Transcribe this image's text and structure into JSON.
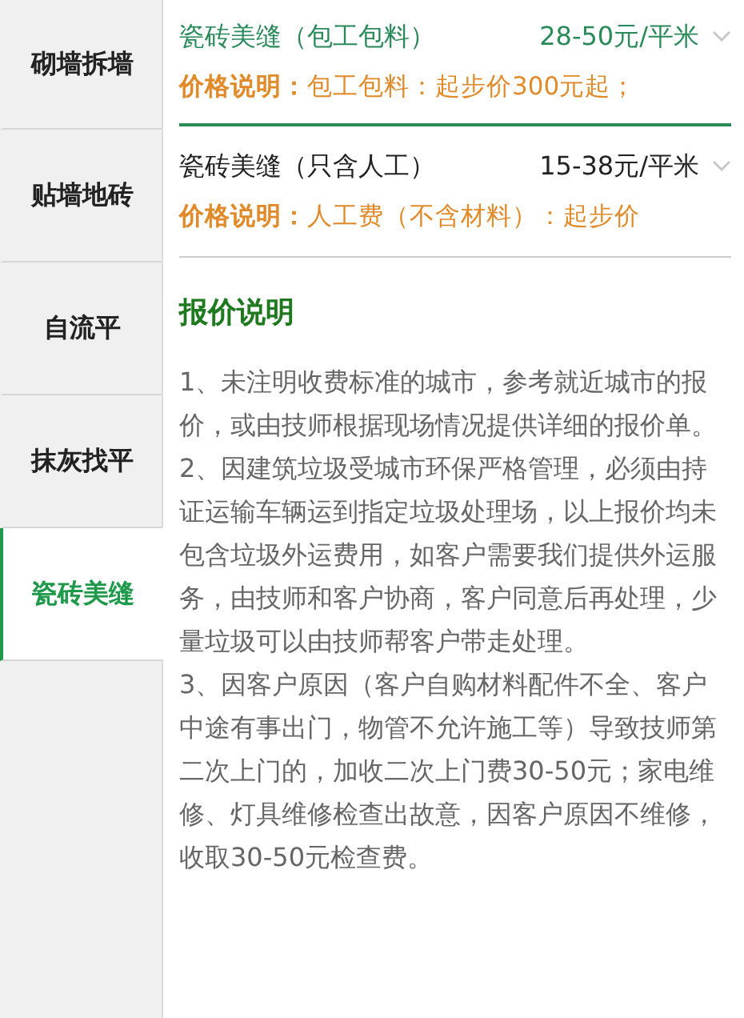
{
  "sidebar": {
    "items": [
      {
        "label": "砌墙拆墙",
        "selected": false
      },
      {
        "label": "贴墙地砖",
        "selected": false
      },
      {
        "label": "自流平",
        "selected": false
      },
      {
        "label": "抹灰找平",
        "selected": false
      },
      {
        "label": "瓷砖美缝",
        "selected": true
      }
    ]
  },
  "prices": [
    {
      "name": "瓷砖美缝（包工包料）",
      "price": "28-50元/平米",
      "note_label": "价格说明：",
      "note": "包工包料：起步价300元起；",
      "selected": true
    },
    {
      "name": "瓷砖美缝（只含人工）",
      "price": "15-38元/平米",
      "note_label": "价格说明：",
      "note": "人工费（不含材料）：起步价",
      "selected": false
    }
  ],
  "explanation": {
    "title": "报价说明",
    "paragraphs": [
      "1、未注明收费标准的城市，参考就近城市的报价，或由技师根据现场情况提供详细的报价单。",
      "2、因建筑垃圾受城市环保严格管理，必须由持证运输车辆运到指定垃圾处理场，以上报价均未包含垃圾外运费用，如客户需要我们提供外运服务，由技师和客户协商，客户同意后再处理，少量垃圾可以由技师帮客户带走处理。",
      "3、因客户原因（客户自购材料配件不全、客户中途有事出门，物管不允许施工等）导致技师第二次上门的，加收二次上门费30-50元；家电维修、灯具维修检查出故意，因客户原因不维修，收取30-50元检查费。"
    ]
  }
}
